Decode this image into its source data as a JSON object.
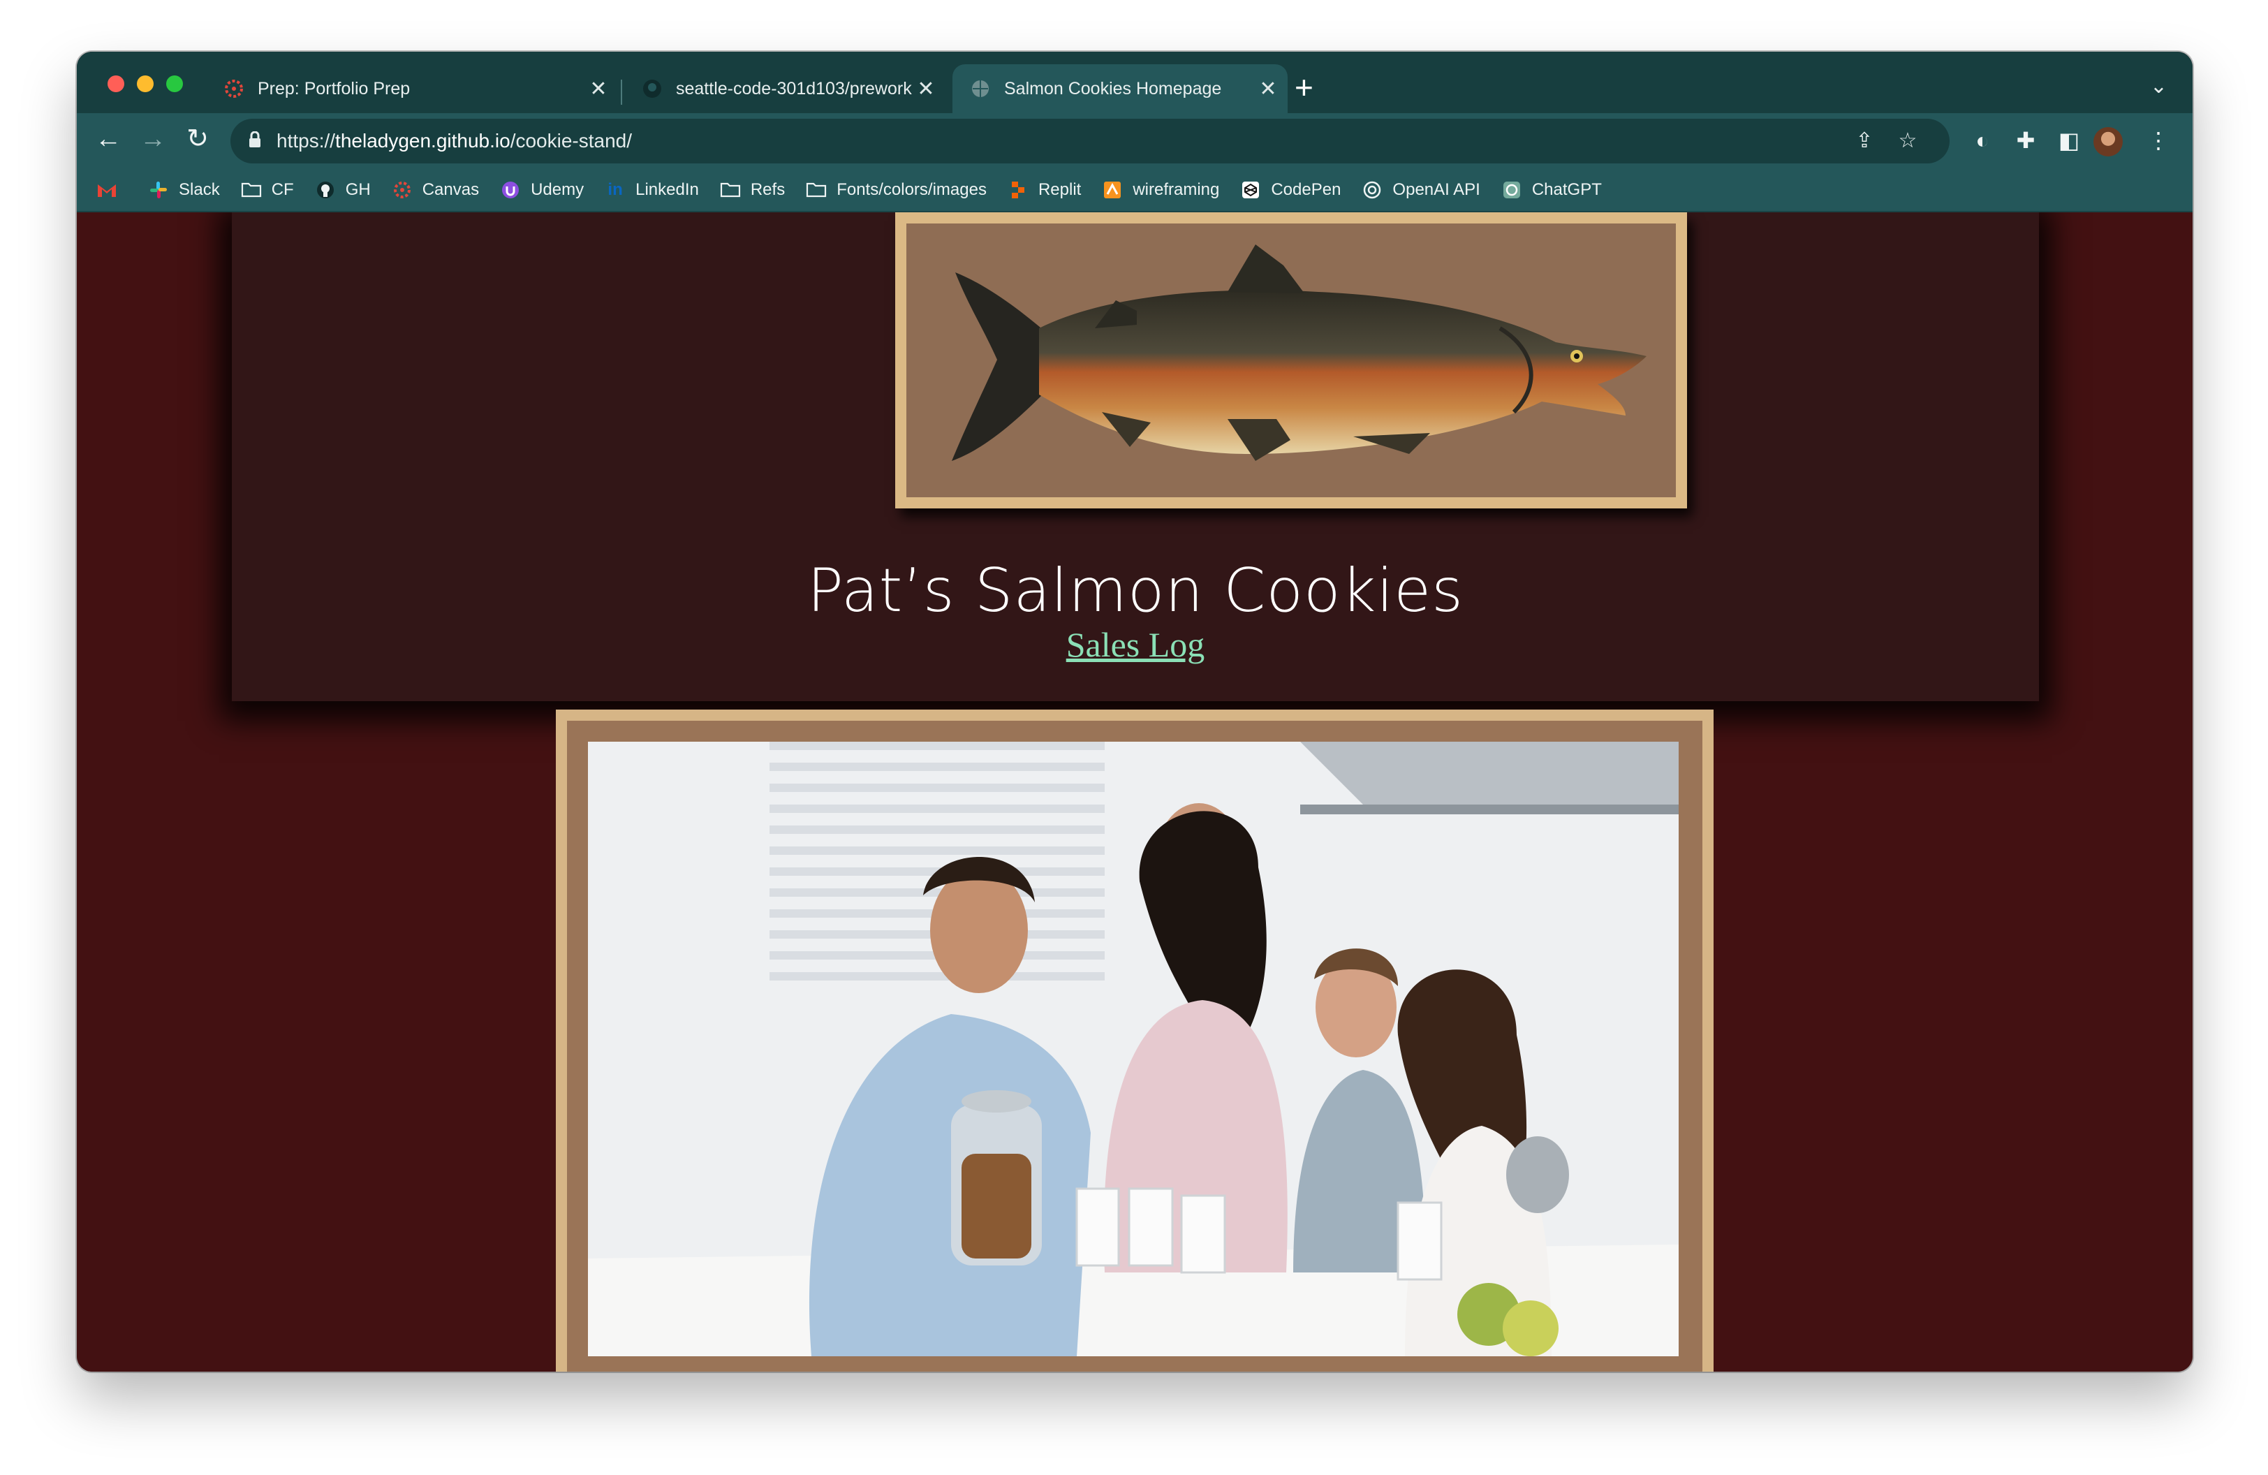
{
  "browser": {
    "tabs": [
      {
        "title": "Prep: Portfolio Prep",
        "active": false,
        "icon": "canvas-icon"
      },
      {
        "title": "seattle-code-301d103/prework",
        "active": false,
        "icon": "github-icon"
      },
      {
        "title": "Salmon Cookies Homepage",
        "active": true,
        "icon": "globe-icon"
      }
    ],
    "url": "https://theladygen.github.io/cookie-stand/",
    "url_host": "theladygen.github.io",
    "url_path": "/cookie-stand/",
    "url_scheme": "https://",
    "bookmarks": [
      {
        "label": "",
        "icon": "gmail-icon"
      },
      {
        "label": "Slack",
        "icon": "slack-icon"
      },
      {
        "label": "CF",
        "icon": "folder-icon"
      },
      {
        "label": "GH",
        "icon": "github-icon"
      },
      {
        "label": "Canvas",
        "icon": "canvas-icon"
      },
      {
        "label": "Udemy",
        "icon": "udemy-icon"
      },
      {
        "label": "LinkedIn",
        "icon": "linkedin-icon"
      },
      {
        "label": "Refs",
        "icon": "folder-icon"
      },
      {
        "label": "Fonts/colors/images",
        "icon": "folder-icon"
      },
      {
        "label": "Replit",
        "icon": "replit-icon"
      },
      {
        "label": "wireframing",
        "icon": "wireframing-icon"
      },
      {
        "label": "CodePen",
        "icon": "codepen-icon"
      },
      {
        "label": "OpenAI API",
        "icon": "openai-icon"
      },
      {
        "label": "ChatGPT",
        "icon": "chatgpt-icon"
      }
    ]
  },
  "page": {
    "title": "Pat’s Salmon Cookies",
    "sales_link": "Sales Log",
    "colors": {
      "page_bg": "#431112",
      "header_bg": "#321617",
      "frame_border": "#dbb985",
      "frame_fill": "#8f6d54",
      "link": "#8be0b6"
    }
  }
}
